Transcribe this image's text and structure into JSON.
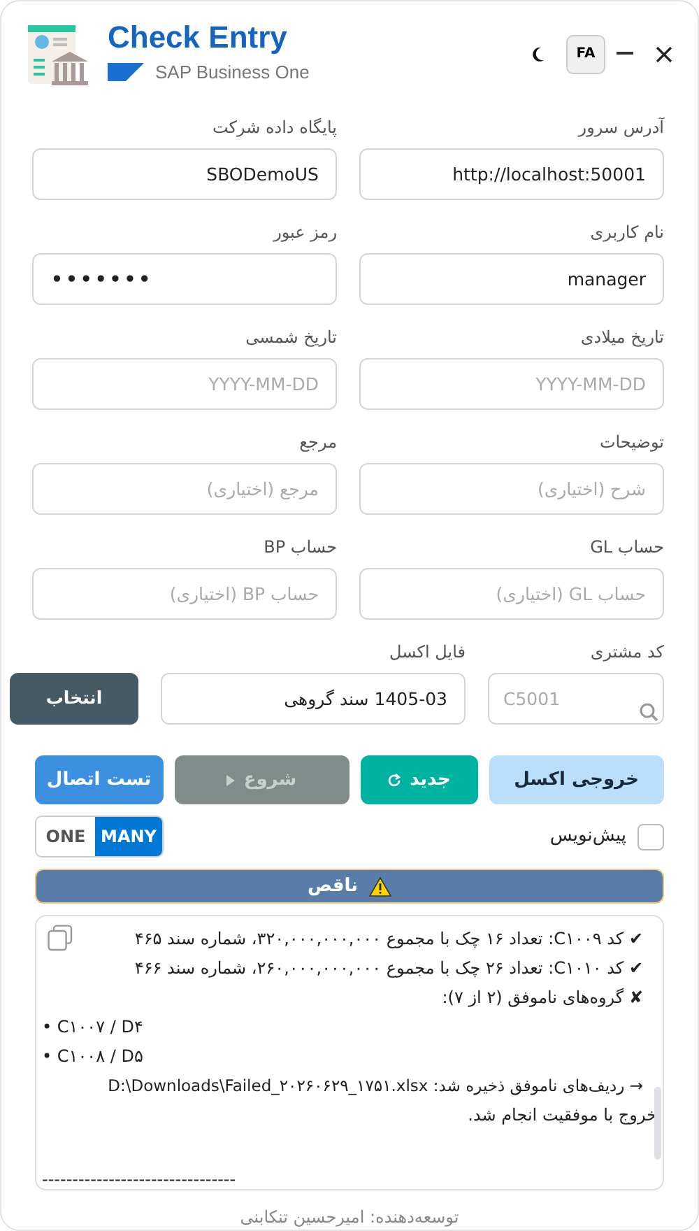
{
  "header": {
    "title": "Check Entry",
    "subtitle": "SAP Business One",
    "language_button": "FA"
  },
  "fields": [
    {
      "label": "آدرس سرور",
      "kind": "text",
      "value": "http://localhost:50001"
    },
    {
      "label": "پایگاه داده شرکت",
      "kind": "text",
      "value": "SBODemoUS"
    },
    {
      "label": "نام کاربری",
      "kind": "text",
      "value": "manager"
    },
    {
      "label": "رمز عبور",
      "kind": "password",
      "value": "•••••••"
    },
    {
      "label": "تاریخ میلادی",
      "kind": "text",
      "placeholder": "YYYY-MM-DD"
    },
    {
      "label": "تاریخ شمسی",
      "kind": "text",
      "placeholder": "YYYY-MM-DD"
    },
    {
      "label": "توضیحات",
      "kind": "text",
      "placeholder": "شرح (اختیاری)"
    },
    {
      "label": "مرجع",
      "kind": "text",
      "placeholder": "مرجع (اختیاری)"
    },
    {
      "label": "حساب GL",
      "kind": "text",
      "placeholder": "حساب GL (اختیاری)"
    },
    {
      "label": "حساب BP",
      "kind": "text",
      "placeholder": "حساب BP (اختیاری)"
    },
    {
      "label": "کد مشتری",
      "kind": "search",
      "placeholder": "C5001"
    },
    {
      "label": "فایل اکسل",
      "kind": "text",
      "value": "1405-03 سند گروهی"
    }
  ],
  "file_button": "انتخاب",
  "actions": [
    {
      "label": "خروجی اکسل",
      "kind": "export",
      "disabled": false
    },
    {
      "label": "جدید",
      "kind": "new",
      "disabled": false
    },
    {
      "label": "شروع",
      "kind": "start",
      "disabled": true
    },
    {
      "label": "تست اتصال",
      "kind": "test",
      "disabled": false
    }
  ],
  "draft": {
    "label": "پیش‌نویس",
    "checked": false
  },
  "mode_toggle": [
    {
      "label": "MANY",
      "selected": true
    },
    {
      "label": "ONE",
      "selected": false
    }
  ],
  "status": {
    "label": "ناقص",
    "kind": "warning"
  },
  "log": [
    {
      "kind": "ok",
      "mark": "✔",
      "text": "کد C۱۰۰۹: تعداد ۱۶ چک با مجموع ۳۲۰,۰۰۰,۰۰۰,۰۰۰، شماره سند ۴۶۵"
    },
    {
      "kind": "ok",
      "mark": "✔",
      "text": "کد C۱۰۱۰: تعداد ۲۶ چک با مجموع ۲۶۰,۰۰۰,۰۰۰,۰۰۰، شماره سند ۴۶۶"
    },
    {
      "kind": "fail",
      "mark": "✘",
      "text": "گروه‌های ناموفق (۲ از ۷):"
    },
    {
      "kind": "bullet",
      "text": "• C۱۰۰۷ / D۴"
    },
    {
      "kind": "bullet",
      "text": "• C۱۰۰۸ / D۵"
    },
    {
      "kind": "info",
      "text": "→ ردیف‌های ناموفق ذخیره شد: D:\\Downloads\\Failed_۲۰۲۶۰۶۲۹_۱۷۵۱.xlsx"
    },
    {
      "kind": "plain",
      "text": "خروج با موفقیت انجام شد."
    },
    {
      "kind": "blank"
    },
    {
      "kind": "rule",
      "text": "--------------------------------"
    }
  ],
  "footer": "توسعه‌دهنده: امیرحسین تنکابنی"
}
